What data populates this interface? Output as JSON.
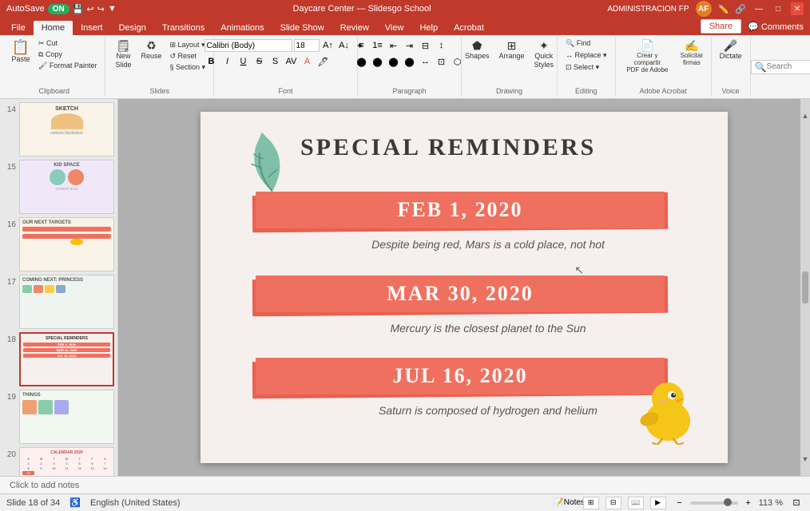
{
  "titlebar": {
    "autosave_label": "AutoSave",
    "autosave_state": "ON",
    "app_title": "Daycare Center — Slidesgo School",
    "admin_label": "ADMINISTRACION FP",
    "window_minimize": "—",
    "window_restore": "□",
    "window_close": "✕"
  },
  "ribbon_tabs": {
    "tabs": [
      "File",
      "Home",
      "Insert",
      "Design",
      "Transitions",
      "Animations",
      "Slide Show",
      "Review",
      "View",
      "Help",
      "Acrobat"
    ],
    "active_tab": "Home",
    "share_label": "Share",
    "comments_label": "Comments"
  },
  "ribbon": {
    "groups": [
      {
        "name": "Clipboard",
        "buttons": [
          {
            "label": "Paste",
            "icon": "📋"
          },
          {
            "label": "Cut",
            "icon": "✂"
          },
          {
            "label": "Copy",
            "icon": "⧉"
          },
          {
            "label": "Format Painter",
            "icon": "🖌"
          }
        ]
      },
      {
        "name": "Slides",
        "buttons": [
          {
            "label": "New Slide",
            "icon": "➕"
          },
          {
            "label": "Reuse",
            "icon": "♻"
          },
          {
            "label": "Layout",
            "icon": "⊞"
          },
          {
            "label": "Reset",
            "icon": "↺"
          },
          {
            "label": "Section",
            "icon": "§"
          }
        ]
      },
      {
        "name": "Font",
        "font_name": "Calibri",
        "font_size": "18",
        "buttons": [
          "B",
          "I",
          "U",
          "S",
          "A",
          "A"
        ]
      },
      {
        "name": "Paragraph",
        "buttons": [
          "list",
          "align-left",
          "align-center",
          "align-right",
          "justify",
          "columns"
        ]
      },
      {
        "name": "Drawing",
        "buttons": [
          "Shapes",
          "Arrange",
          "Quick Styles",
          "Replace"
        ]
      },
      {
        "name": "Editing",
        "buttons": [
          "Find",
          "Replace",
          "Select"
        ]
      },
      {
        "name": "Adobe Acrobat",
        "buttons": [
          "Crear y compartir PDF de Adobe",
          "Solicitar firmas"
        ]
      },
      {
        "name": "Voice",
        "buttons": [
          "Dictate"
        ]
      }
    ]
  },
  "slide_panel": {
    "slides": [
      {
        "num": "14",
        "active": false
      },
      {
        "num": "15",
        "active": false
      },
      {
        "num": "16",
        "active": false
      },
      {
        "num": "17",
        "active": false
      },
      {
        "num": "18",
        "active": true
      },
      {
        "num": "19",
        "active": false
      },
      {
        "num": "20",
        "active": false
      }
    ]
  },
  "slide": {
    "title": "SPECIAL REMINDERS",
    "items": [
      {
        "date": "FEB 1, 2020",
        "description": "Despite being red, Mars is a cold place, not hot"
      },
      {
        "date": "MAR 30, 2020",
        "description": "Mercury is the closest planet to the Sun"
      },
      {
        "date": "JUL 16, 2020",
        "description": "Saturn is composed of hydrogen and helium"
      }
    ],
    "notes_placeholder": "Click to add notes"
  },
  "status_bar": {
    "slide_info": "Slide 18 of 34",
    "language": "English (United States)",
    "notes_label": "Notes",
    "zoom_level": "113 %",
    "view_normal": "⊞",
    "view_slide_sorter": "⊟",
    "view_reading": "📖",
    "view_presentation": "▶"
  }
}
